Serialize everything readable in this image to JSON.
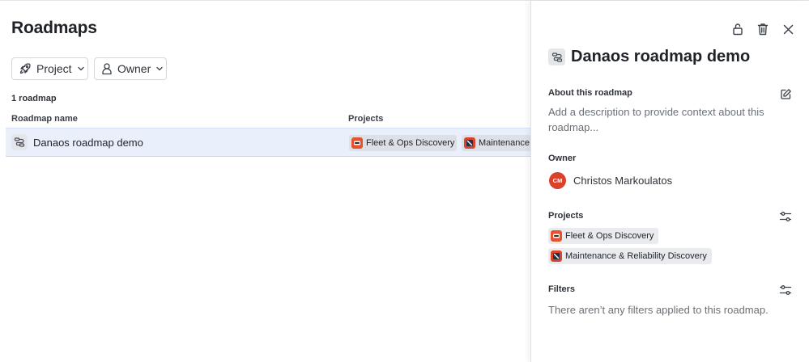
{
  "page": {
    "title": "Roadmaps",
    "filters": {
      "project_label": "Project",
      "owner_label": "Owner"
    },
    "count_text": "1 roadmap",
    "table": {
      "columns": [
        "Roadmap name",
        "Projects"
      ],
      "rows": [
        {
          "name": "Danaos roadmap demo",
          "projects": [
            "Fleet & Ops Discovery",
            "Maintenance"
          ]
        }
      ]
    }
  },
  "panel": {
    "title": "Danaos roadmap demo",
    "about": {
      "label": "About this roadmap",
      "placeholder": "Add a description to provide context about this roadmap..."
    },
    "owner": {
      "label": "Owner",
      "initials": "CM",
      "name": "Christos Markoulatos",
      "avatar_color": "#d9412b"
    },
    "projects": {
      "label": "Projects",
      "items": [
        "Fleet & Ops Discovery",
        "Maintenance & Reliability Discovery"
      ]
    },
    "filters": {
      "label": "Filters",
      "empty_text": "There aren’t any filters applied to this roadmap."
    }
  },
  "icons": {
    "header_actions": [
      "lock-open-icon",
      "trash-icon",
      "close-icon"
    ],
    "filter_project": "rocket-icon",
    "filter_owner": "person-icon",
    "roadmap": "roadmap-icon",
    "edit": "edit-icon",
    "settings": "sliders-icon"
  },
  "colors": {
    "row_highlight": "#e9f0fb",
    "project_fleet": "#e5532e",
    "project_maintenance": "#d9442a"
  }
}
